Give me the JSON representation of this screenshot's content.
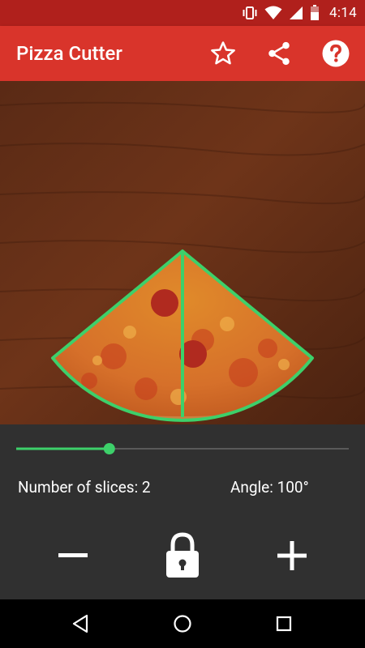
{
  "status_bar": {
    "time": "4:14",
    "icons": [
      "vibrate-icon",
      "wifi-icon",
      "signal-icon",
      "battery-icon"
    ]
  },
  "app_bar": {
    "title": "Pizza Cutter",
    "actions": [
      "star-icon",
      "share-icon",
      "help-icon"
    ],
    "color": "#d9342b"
  },
  "canvas": {
    "slice_count": 2,
    "angle_degrees": 100,
    "guide_color": "#3dd06a"
  },
  "controls": {
    "slider_fraction": 0.28,
    "slices_label": "Number of slices: 2",
    "angle_label": "Angle: 100°",
    "buttons": [
      "minus-icon",
      "lock-icon",
      "plus-icon"
    ]
  },
  "nav_bar": {
    "buttons": [
      "back-icon",
      "home-icon",
      "recents-icon"
    ]
  }
}
